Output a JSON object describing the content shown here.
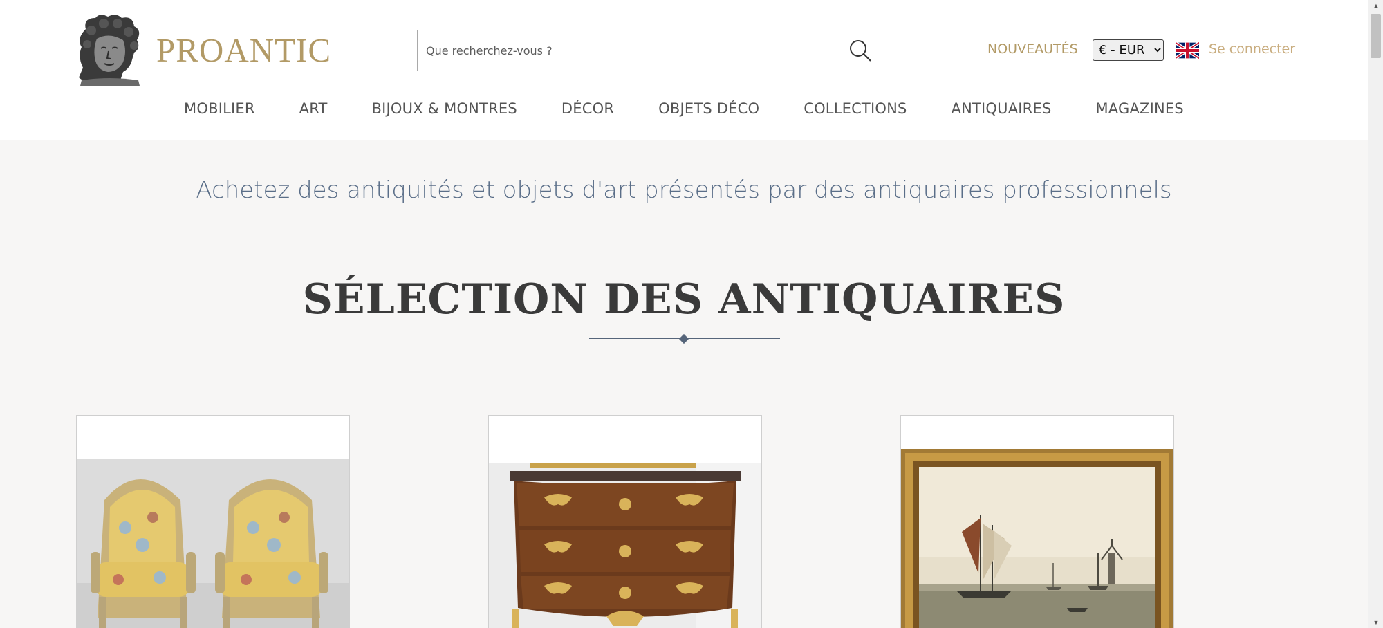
{
  "header": {
    "logo_text": "PROANTIC",
    "search_placeholder": "Que recherchez-vous ?",
    "new_label": "NOUVEAUTÉS",
    "currency_selected": "€ - EUR",
    "language_icon": "uk-flag-icon",
    "signin_label": "Se connecter"
  },
  "nav": {
    "items": [
      {
        "label": "MOBILIER"
      },
      {
        "label": "ART"
      },
      {
        "label": "BIJOUX & MONTRES"
      },
      {
        "label": "DÉCOR"
      },
      {
        "label": "OBJETS DÉCO"
      },
      {
        "label": "COLLECTIONS"
      },
      {
        "label": "ANTIQUAIRES"
      },
      {
        "label": "MAGAZINES"
      }
    ]
  },
  "main": {
    "tagline": "Achetez des antiquités et objets d'art présentés par des antiquaires professionnels",
    "section_title": "SÉLECTION DES ANTIQUAIRES",
    "cards": [
      {
        "image": "pair-of-yellow-armchairs"
      },
      {
        "image": "walnut-chest-of-drawers"
      },
      {
        "image": "sailing-ship-painting"
      }
    ]
  },
  "colors": {
    "brand_gold": "#b29a66",
    "tagline_blue": "#5a6e88",
    "background": "#f7f6f5"
  }
}
